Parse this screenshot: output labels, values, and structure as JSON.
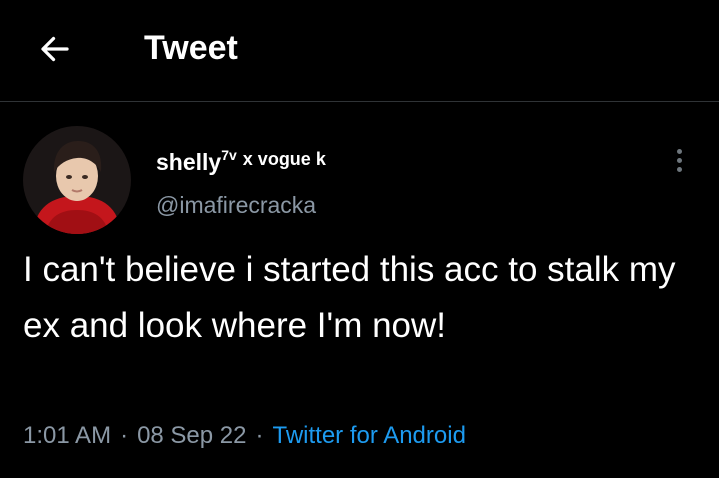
{
  "header": {
    "title": "Tweet",
    "back_icon": "arrow-left-icon"
  },
  "author": {
    "display_name": "shelly",
    "name_superscript": "7v",
    "name_suffix": "x vogue k",
    "handle": "@imafirecracka",
    "avatar": "avatar-photo"
  },
  "tweet": {
    "text": "I can't believe i started this acc to stalk my ex and look where I'm now!",
    "time": "1:01 AM",
    "separator": "·",
    "date": "08 Sep 22",
    "source": "Twitter for Android"
  },
  "more_icon": "more-vertical-icon",
  "colors": {
    "background": "#000000",
    "text": "#ffffff",
    "muted": "#8b98a5",
    "link": "#1d9bf0",
    "divider": "#2f3336"
  }
}
